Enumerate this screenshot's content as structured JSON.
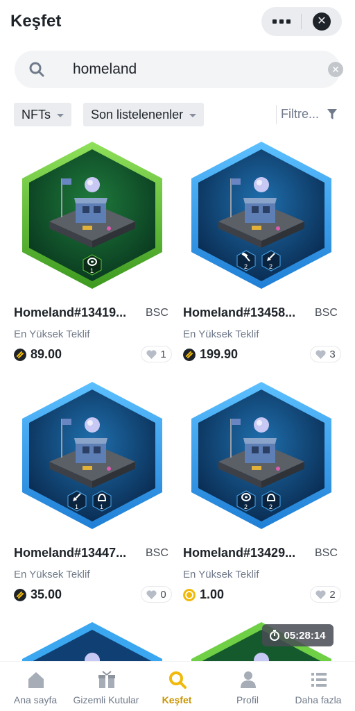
{
  "header": {
    "title": "Keşfet"
  },
  "search": {
    "query": "homeland"
  },
  "filters": {
    "type_label": "NFTs",
    "sort_label": "Son listelenenler",
    "filter_label": "Filtre..."
  },
  "cards": [
    {
      "name": "Homeland#13419...",
      "chain": "BSC",
      "bid_label": "En Yüksek Teklif",
      "price": "89.00",
      "likes": "1",
      "frame_color": "green",
      "coin": "bnb-dark"
    },
    {
      "name": "Homeland#13458...",
      "chain": "BSC",
      "bid_label": "En Yüksek Teklif",
      "price": "199.90",
      "likes": "3",
      "frame_color": "blue",
      "coin": "bnb-dark"
    },
    {
      "name": "Homeland#13447...",
      "chain": "BSC",
      "bid_label": "En Yüksek Teklif",
      "price": "35.00",
      "likes": "0",
      "frame_color": "blue",
      "coin": "bnb-dark"
    },
    {
      "name": "Homeland#13429...",
      "chain": "BSC",
      "bid_label": "En Yüksek Teklif",
      "price": "1.00",
      "likes": "2",
      "frame_color": "blue",
      "coin": "bnb-yellow"
    }
  ],
  "badges": {
    "card0": [
      {
        "icon": "disc-icon",
        "count": "1"
      }
    ],
    "card1": [
      {
        "icon": "hammer-icon",
        "count": "2"
      },
      {
        "icon": "shovel-icon",
        "count": "2"
      }
    ],
    "card2": [
      {
        "icon": "shovel-icon",
        "count": "1"
      },
      {
        "icon": "helmet-icon",
        "count": "1"
      }
    ],
    "card3": [
      {
        "icon": "disc-icon",
        "count": "2"
      },
      {
        "icon": "helmet-icon",
        "count": "2"
      }
    ]
  },
  "timer": {
    "value": "05:28:14"
  },
  "nav": {
    "home": "Ana sayfa",
    "mystery": "Gizemli Kutular",
    "explore": "Keşfet",
    "profile": "Profil",
    "more": "Daha fazla"
  },
  "colors": {
    "accent": "#f0b90b",
    "nav_active": "#c99400",
    "blue_frame": "#2d9be8",
    "green_frame": "#5fc43a"
  }
}
